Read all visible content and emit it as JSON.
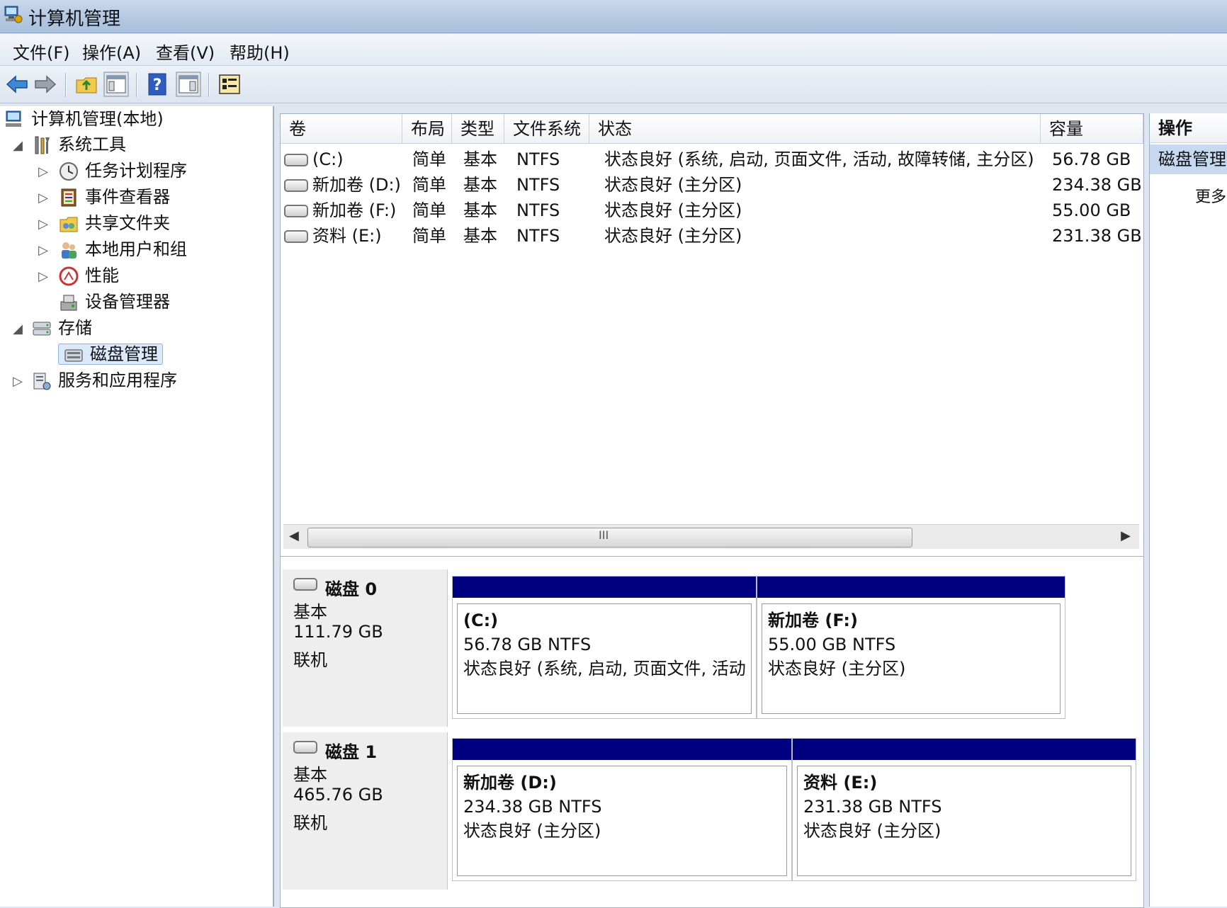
{
  "window": {
    "title": "计算机管理"
  },
  "menu": [
    "文件(F)",
    "操作(A)",
    "查看(V)",
    "帮助(H)"
  ],
  "tree": {
    "root": "计算机管理(本地)",
    "system_tools": "系统工具",
    "task_scheduler": "任务计划程序",
    "event_viewer": "事件查看器",
    "shared_folders": "共享文件夹",
    "local_users": "本地用户和组",
    "performance": "性能",
    "device_manager": "设备管理器",
    "storage": "存储",
    "disk_management": "磁盘管理",
    "services_apps": "服务和应用程序"
  },
  "list": {
    "headers": [
      "卷",
      "布局",
      "类型",
      "文件系统",
      "状态",
      "容量"
    ],
    "rows": [
      {
        "vol": "(C:)",
        "layout": "简单",
        "type": "基本",
        "fs": "NTFS",
        "status": "状态良好 (系统, 启动, 页面文件, 活动, 故障转储, 主分区)",
        "cap": "56.78 GB"
      },
      {
        "vol": "新加卷 (D:)",
        "layout": "简单",
        "type": "基本",
        "fs": "NTFS",
        "status": "状态良好 (主分区)",
        "cap": "234.38 GB"
      },
      {
        "vol": "新加卷 (F:)",
        "layout": "简单",
        "type": "基本",
        "fs": "NTFS",
        "status": "状态良好 (主分区)",
        "cap": "55.00 GB"
      },
      {
        "vol": "资料 (E:)",
        "layout": "简单",
        "type": "基本",
        "fs": "NTFS",
        "status": "状态良好 (主分区)",
        "cap": "231.38 GB"
      }
    ],
    "scroll_grip": "III"
  },
  "disks": [
    {
      "name": "磁盘 0",
      "kind": "基本",
      "size": "111.79 GB",
      "state": "联机",
      "partitions": [
        {
          "title": "(C:)",
          "size": "56.78 GB NTFS",
          "status": "状态良好 (系统, 启动, 页面文件, 活动"
        },
        {
          "title": "新加卷  (F:)",
          "size": "55.00 GB NTFS",
          "status": "状态良好 (主分区)"
        }
      ]
    },
    {
      "name": "磁盘 1",
      "kind": "基本",
      "size": "465.76 GB",
      "state": "联机",
      "partitions": [
        {
          "title": "新加卷  (D:)",
          "size": "234.38 GB NTFS",
          "status": "状态良好 (主分区)"
        },
        {
          "title": "资料  (E:)",
          "size": "231.38 GB NTFS",
          "status": "状态良好 (主分区)"
        }
      ]
    }
  ],
  "actions": {
    "header": "操作",
    "item": "磁盘管理",
    "more": "更多"
  },
  "colors": {
    "partition_bar": "#000080",
    "selection": "#dbe9fb"
  }
}
